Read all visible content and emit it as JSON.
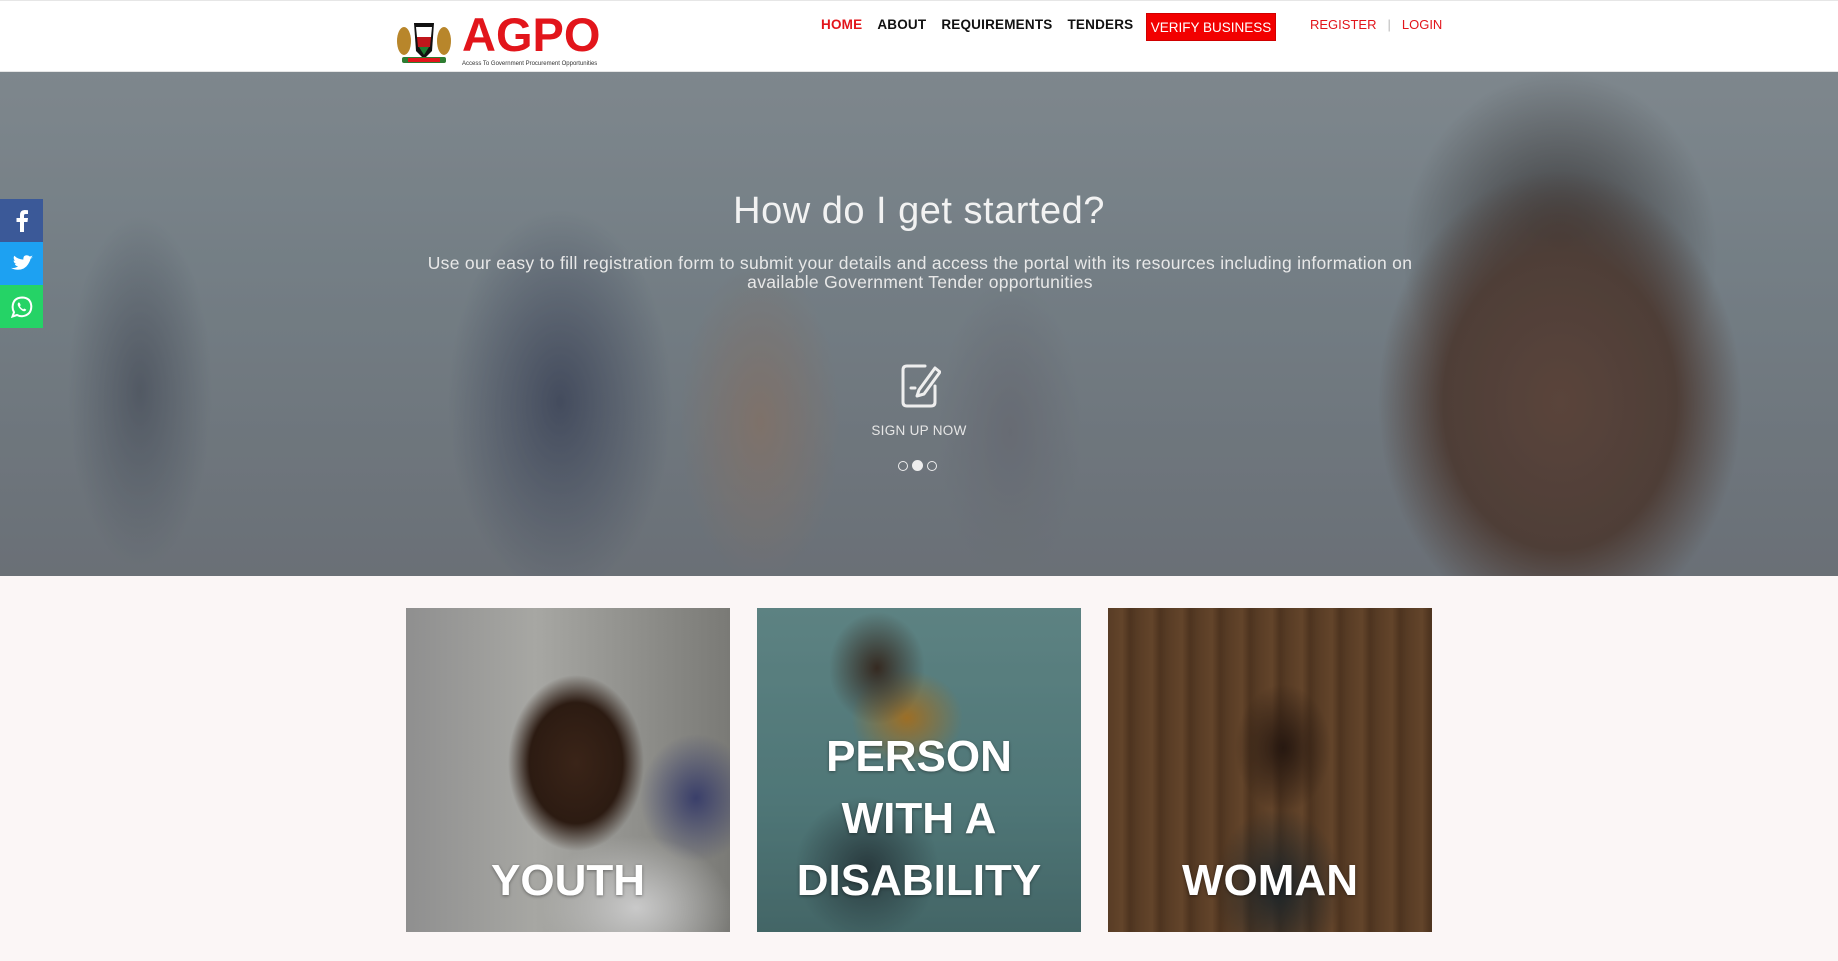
{
  "header": {
    "logo_text": "AGPO",
    "logo_tagline": "Access To Government Procurement Opportunities",
    "nav": [
      {
        "label": "HOME",
        "active": true
      },
      {
        "label": "ABOUT",
        "active": false
      },
      {
        "label": "REQUIREMENTS",
        "active": false
      },
      {
        "label": "TENDERS",
        "active": false
      }
    ],
    "verify_button": "VERIFY BUSINESS",
    "register_label": "REGISTER",
    "auth_separator": "|",
    "login_label": "LOGIN",
    "accent_color": "#e2151b"
  },
  "hero": {
    "title": "How do I get started?",
    "subtitle": "Use our easy to fill registration form to submit your details and access the portal with its resources including information on available Government Tender opportunities",
    "cta_label": "SIGN UP NOW",
    "cta_icon": "edit-document-icon",
    "slides": 3,
    "active_slide": 2
  },
  "social": [
    {
      "name": "facebook-icon",
      "glyph": "f",
      "color": "#3b5998"
    },
    {
      "name": "twitter-icon",
      "glyph": "t",
      "color": "#1da1f2"
    },
    {
      "name": "whatsapp-icon",
      "glyph": "w",
      "color": "#25d366"
    }
  ],
  "cards": [
    {
      "lines": [
        "YOUTH"
      ]
    },
    {
      "lines": [
        "PERSON",
        "WITH A",
        "DISABILITY"
      ]
    },
    {
      "lines": [
        "WOMAN"
      ]
    }
  ]
}
